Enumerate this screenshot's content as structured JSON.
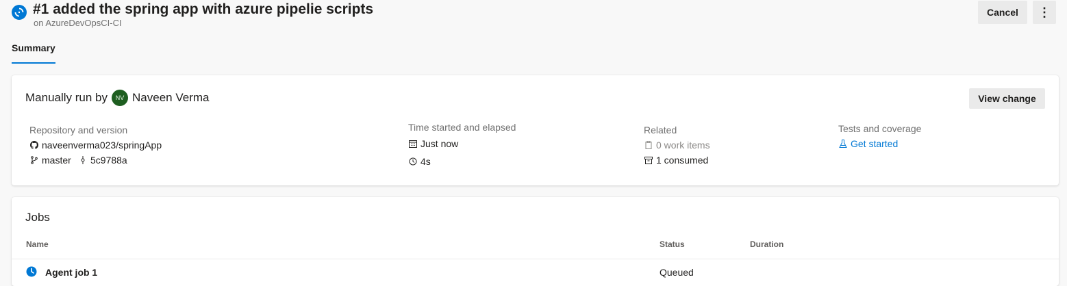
{
  "header": {
    "title": "#1 added the spring app with azure pipelie scripts",
    "subtitle": "on AzureDevOpsCI-CI",
    "cancel_label": "Cancel",
    "more_label": "⋮"
  },
  "tabs": [
    {
      "label": "Summary",
      "selected": true
    }
  ],
  "summary": {
    "run_by_prefix": "Manually run by",
    "avatar_initials": "NV",
    "user_name": "Naveen Verma",
    "view_change_label": "View change",
    "repository": {
      "label": "Repository and version",
      "repo": "naveenverma023/springApp",
      "branch": "master",
      "commit": "5c9788a"
    },
    "time": {
      "label": "Time started and elapsed",
      "started": "Just now",
      "elapsed": "4s"
    },
    "related": {
      "label": "Related",
      "work_items": "0 work items",
      "consumed": "1 consumed"
    },
    "tests": {
      "label": "Tests and coverage",
      "link": "Get started"
    }
  },
  "jobs": {
    "title": "Jobs",
    "columns": [
      "Name",
      "Status",
      "Duration"
    ],
    "rows": [
      {
        "name": "Agent job 1",
        "status": "Queued",
        "duration": ""
      }
    ]
  },
  "colors": {
    "accent": "#0078d4",
    "avatar_bg": "#1e5e20",
    "page_bg": "#f8f8f8"
  },
  "icons": {
    "run_status": "in-progress-icon",
    "repo": "github-icon",
    "branch": "branch-icon",
    "commit": "commit-icon",
    "calendar": "calendar-icon",
    "clock": "clock-icon",
    "work_item": "clipboard-icon",
    "artifact": "artifact-icon",
    "tests": "flask-icon",
    "job_status": "queued-clock-icon"
  }
}
